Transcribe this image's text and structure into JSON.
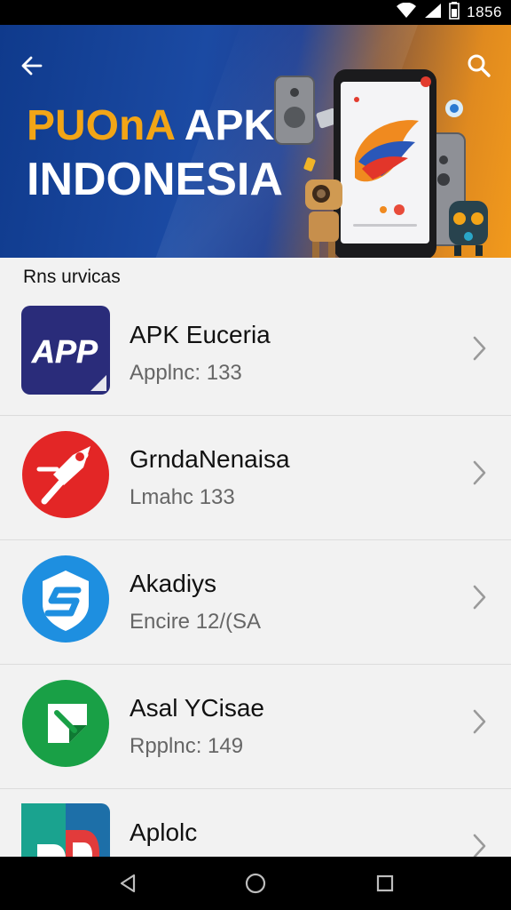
{
  "status_bar": {
    "time": "1856",
    "icons": [
      "wifi-icon",
      "signal-icon",
      "battery-icon"
    ]
  },
  "banner": {
    "title_accent": "PUOnA",
    "title_rest": " APK",
    "title_line2": "INDONESIA",
    "icons": [
      "back-arrow-icon",
      "search-icon"
    ],
    "colors": {
      "blue": "#1b4aa3",
      "orange": "#f29a1c",
      "accent_text": "#f2a516"
    }
  },
  "section": {
    "header": "Rns urvicas"
  },
  "apps": [
    {
      "name": "APK Euceria",
      "sub": "Applnc: 133",
      "icon": "app-text-icon",
      "icon_text": "APP",
      "color": "#2a2c7a"
    },
    {
      "name": "GrndaNenaisa",
      "sub": "Lmahc 133",
      "icon": "pen-nib-icon",
      "color": "#e32626"
    },
    {
      "name": "Akadiys",
      "sub": "Encire 12/(SA",
      "icon": "shield-s-icon",
      "color": "#1e8fe0"
    },
    {
      "name": "Asal YCisae",
      "sub": "Rpplnc: 149",
      "icon": "folded-paper-icon",
      "color": "#19a046"
    },
    {
      "name": "Aplolc",
      "sub": "",
      "icon": "multicolor-d-icon",
      "color": "#1d6fa8"
    }
  ],
  "nav_bar": {
    "icons": [
      "back-triangle-icon",
      "home-circle-icon",
      "recents-square-icon"
    ]
  }
}
